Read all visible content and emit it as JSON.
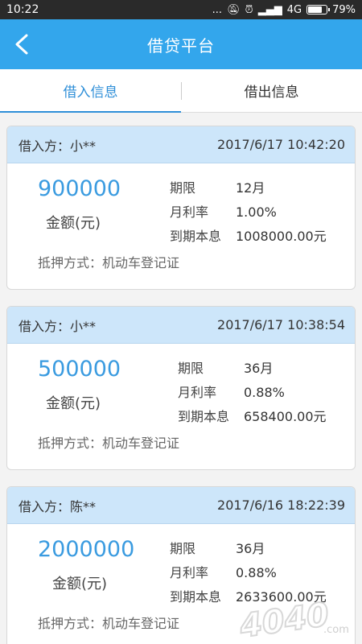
{
  "status_bar": {
    "time": "10:22",
    "dots": "...",
    "network": "4G",
    "battery": "79%",
    "battery_level": 0.79
  },
  "header": {
    "title": "借贷平台",
    "back_icon": "back-arrow-icon"
  },
  "tabs": [
    {
      "label": "借入信息",
      "active": true
    },
    {
      "label": "借出信息",
      "active": false
    }
  ],
  "labels": {
    "amount_unit": "金额(元)",
    "term": "期限",
    "monthly_rate": "月利率",
    "maturity": "到期本息"
  },
  "loans": [
    {
      "borrower": "借入方：小**",
      "datetime": "2017/6/17 10:42:20",
      "amount": "900000",
      "term": "12月",
      "rate": "1.00%",
      "maturity": "1008000.00元",
      "collateral": "抵押方式：机动车登记证"
    },
    {
      "borrower": "借入方：小**",
      "datetime": "2017/6/17 10:38:54",
      "amount": "500000",
      "term": "36月",
      "rate": "0.88%",
      "maturity": "658400.00元",
      "collateral": "抵押方式：机动车登记证"
    },
    {
      "borrower": "借入方：陈**",
      "datetime": "2017/6/16 18:22:39",
      "amount": "2000000",
      "term": "36月",
      "rate": "0.88%",
      "maturity": "2633600.00元",
      "collateral": "抵押方式：机动车登记证"
    }
  ],
  "watermark": {
    "text": "4040",
    "suffix": ".com"
  }
}
